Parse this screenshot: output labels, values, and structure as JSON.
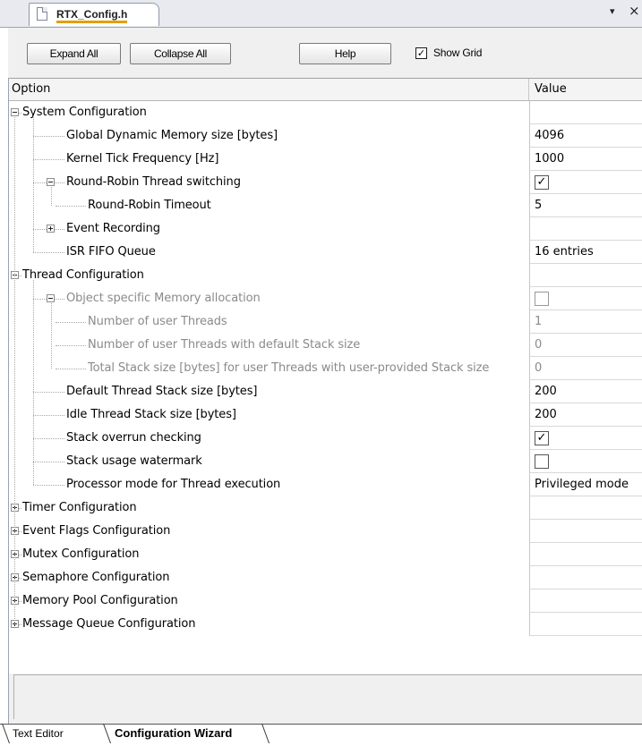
{
  "document_tab": {
    "title": "RTX_Config.h",
    "dropdown_icon": "▾",
    "close_icon": "×"
  },
  "toolbar": {
    "expand_all": "Expand All",
    "collapse_all": "Collapse All",
    "help": "Help",
    "show_grid_label": "Show Grid",
    "show_grid_checked": true
  },
  "grid": {
    "headers": {
      "option": "Option",
      "value": "Value"
    },
    "rows": [
      {
        "label": "System Configuration",
        "level": 0,
        "expander": "minus",
        "value": "",
        "type": "none",
        "disabled": false
      },
      {
        "label": "Global Dynamic Memory size [bytes]",
        "level": 1,
        "expander": "",
        "value": "4096",
        "type": "text",
        "disabled": false
      },
      {
        "label": "Kernel Tick Frequency [Hz]",
        "level": 1,
        "expander": "",
        "value": "1000",
        "type": "text",
        "disabled": false
      },
      {
        "label": "Round-Robin Thread switching",
        "level": 1,
        "expander": "minus",
        "value": "",
        "type": "check",
        "checked": true,
        "disabled": false
      },
      {
        "label": "Round-Robin Timeout",
        "level": 2,
        "expander": "",
        "value": "5",
        "type": "text",
        "disabled": false
      },
      {
        "label": "Event Recording",
        "level": 1,
        "expander": "plus",
        "value": "",
        "type": "none",
        "disabled": false
      },
      {
        "label": "ISR FIFO Queue",
        "level": 1,
        "expander": "",
        "value": "16 entries",
        "type": "text",
        "disabled": false
      },
      {
        "label": "Thread Configuration",
        "level": 0,
        "expander": "minus",
        "value": "",
        "type": "none",
        "disabled": false
      },
      {
        "label": "Object specific Memory allocation",
        "level": 1,
        "expander": "minus",
        "value": "",
        "type": "check",
        "checked": false,
        "disabled": true
      },
      {
        "label": "Number of user Threads",
        "level": 2,
        "expander": "",
        "value": "1",
        "type": "text",
        "disabled": true
      },
      {
        "label": "Number of user Threads with default Stack size",
        "level": 2,
        "expander": "",
        "value": "0",
        "type": "text",
        "disabled": true
      },
      {
        "label": "Total Stack size [bytes] for user Threads with user-provided Stack size",
        "level": 2,
        "expander": "",
        "value": "0",
        "type": "text",
        "disabled": true
      },
      {
        "label": "Default Thread Stack size [bytes]",
        "level": 1,
        "expander": "",
        "value": "200",
        "type": "text",
        "disabled": false
      },
      {
        "label": "Idle Thread Stack size [bytes]",
        "level": 1,
        "expander": "",
        "value": "200",
        "type": "text",
        "disabled": false
      },
      {
        "label": "Stack overrun checking",
        "level": 1,
        "expander": "",
        "value": "",
        "type": "check",
        "checked": true,
        "disabled": false
      },
      {
        "label": "Stack usage watermark",
        "level": 1,
        "expander": "",
        "value": "",
        "type": "check",
        "checked": false,
        "disabled": false
      },
      {
        "label": "Processor mode for Thread execution",
        "level": 1,
        "expander": "",
        "value": "Privileged mode",
        "type": "text",
        "disabled": false
      },
      {
        "label": "Timer Configuration",
        "level": 0,
        "expander": "plus",
        "value": "",
        "type": "none",
        "disabled": false
      },
      {
        "label": "Event Flags Configuration",
        "level": 0,
        "expander": "plus",
        "value": "",
        "type": "none",
        "disabled": false
      },
      {
        "label": "Mutex Configuration",
        "level": 0,
        "expander": "plus",
        "value": "",
        "type": "none",
        "disabled": false
      },
      {
        "label": "Semaphore Configuration",
        "level": 0,
        "expander": "plus",
        "value": "",
        "type": "none",
        "disabled": false
      },
      {
        "label": "Memory Pool Configuration",
        "level": 0,
        "expander": "plus",
        "value": "",
        "type": "none",
        "disabled": false
      },
      {
        "label": "Message Queue Configuration",
        "level": 0,
        "expander": "plus",
        "value": "",
        "type": "none",
        "disabled": false
      }
    ]
  },
  "bottom_tabs": {
    "text_editor": "Text Editor",
    "configuration_wizard": "Configuration Wizard"
  }
}
